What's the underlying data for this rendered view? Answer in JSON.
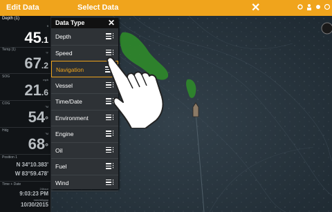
{
  "topbar": {
    "left_label": "Edit Data",
    "center_label": "Select Data",
    "close_glyph": "✕",
    "icons": [
      "settings-icon",
      "person-icon",
      "sun-icon",
      "alarm-icon"
    ]
  },
  "databar": {
    "depth": {
      "label": "Depth (1)",
      "unit": "ft",
      "value": "45",
      "decimal": ".1"
    },
    "temp": {
      "label": "Temp (1)",
      "unit": "°F",
      "value": "67",
      "decimal": ".2"
    },
    "sog": {
      "label": "SOG",
      "unit": "mph",
      "value": "21",
      "decimal": ".6"
    },
    "cog": {
      "label": "COG",
      "unit": "°M",
      "value": "54",
      "decimal": "°"
    },
    "hdg": {
      "label": "Hdg",
      "unit": "°M",
      "value": "68",
      "decimal": "°"
    },
    "position": {
      "label": "Position 1",
      "lat": "N 34°10.383'",
      "lon": "W 83°59.478'"
    },
    "time_date": {
      "label": "Time + Date",
      "sub1": "24hour",
      "time": "9:03:23 PM",
      "sub2": "mm/dd/yyyy",
      "date": "10/30/2015"
    }
  },
  "menu": {
    "title": "Data Type",
    "close_glyph": "✕",
    "items": [
      {
        "label": "Depth",
        "has_submenu": true,
        "selected": false
      },
      {
        "label": "Speed",
        "has_submenu": true,
        "selected": false
      },
      {
        "label": "Navigation",
        "has_submenu": true,
        "selected": true
      },
      {
        "label": "Vessel",
        "has_submenu": true,
        "selected": false
      },
      {
        "label": "Time/Date",
        "has_submenu": true,
        "selected": false
      },
      {
        "label": "Environment",
        "has_submenu": true,
        "selected": false
      },
      {
        "label": "Engine",
        "has_submenu": true,
        "selected": false
      },
      {
        "label": "Oil",
        "has_submenu": true,
        "selected": false
      },
      {
        "label": "Fuel",
        "has_submenu": true,
        "selected": false
      },
      {
        "label": "Wind",
        "has_submenu": true,
        "selected": false
      }
    ]
  },
  "colors": {
    "accent": "#f0a41c",
    "land": "#2f8a2a",
    "water": "#2a3640"
  }
}
